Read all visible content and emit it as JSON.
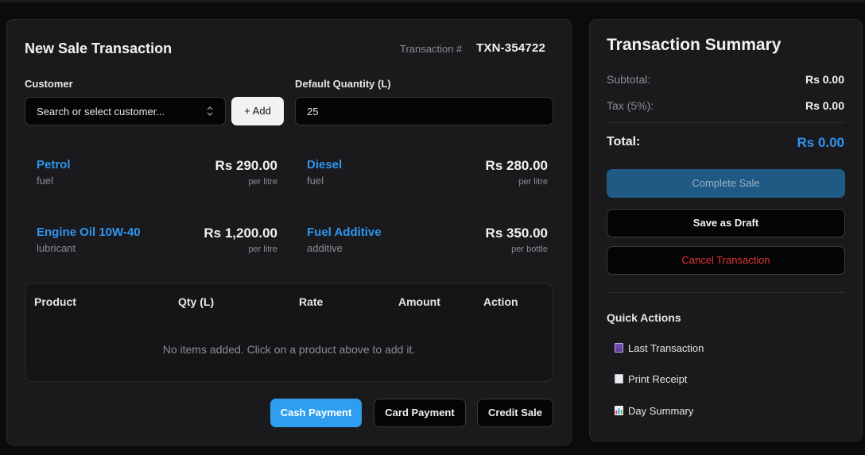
{
  "sale": {
    "title": "New Sale Transaction",
    "txn_label": "Transaction #",
    "txn_number": "TXN-354722",
    "customer_label": "Customer",
    "customer_placeholder": "Search or select customer...",
    "add_label": "+ Add",
    "qty_label": "Default Quantity (L)",
    "qty_value": "25"
  },
  "products": [
    {
      "name": "Petrol",
      "category": "fuel",
      "price": "Rs 290.00",
      "unit": "per litre"
    },
    {
      "name": "Diesel",
      "category": "fuel",
      "price": "Rs 280.00",
      "unit": "per litre"
    },
    {
      "name": "Engine Oil 10W-40",
      "category": "lubricant",
      "price": "Rs 1,200.00",
      "unit": "per litre"
    },
    {
      "name": "Fuel Additive",
      "category": "additive",
      "price": "Rs 350.00",
      "unit": "per bottle"
    }
  ],
  "table": {
    "headers": [
      "Product",
      "Qty (L)",
      "Rate",
      "Amount",
      "Action"
    ],
    "empty_message": "No items added. Click on a product above to add it."
  },
  "payment": {
    "cash": "Cash Payment",
    "card": "Card Payment",
    "credit": "Credit Sale"
  },
  "summary": {
    "title": "Transaction Summary",
    "subtotal_label": "Subtotal:",
    "subtotal_value": "Rs 0.00",
    "tax_label": "Tax (5%):",
    "tax_value": "Rs 0.00",
    "total_label": "Total:",
    "total_value": "Rs 0.00",
    "complete_label": "Complete Sale",
    "draft_label": "Save as Draft",
    "cancel_label": "Cancel Transaction"
  },
  "quick_actions": {
    "title": "Quick Actions",
    "items": [
      {
        "label": "Last Transaction",
        "icon": "receipt-icon"
      },
      {
        "label": "Print Receipt",
        "icon": "page-icon"
      },
      {
        "label": "Day Summary",
        "icon": "bar-chart-icon"
      }
    ]
  },
  "colors": {
    "accent": "#2e95ee",
    "danger": "#e0323a",
    "panel": "#1a1a1d"
  }
}
